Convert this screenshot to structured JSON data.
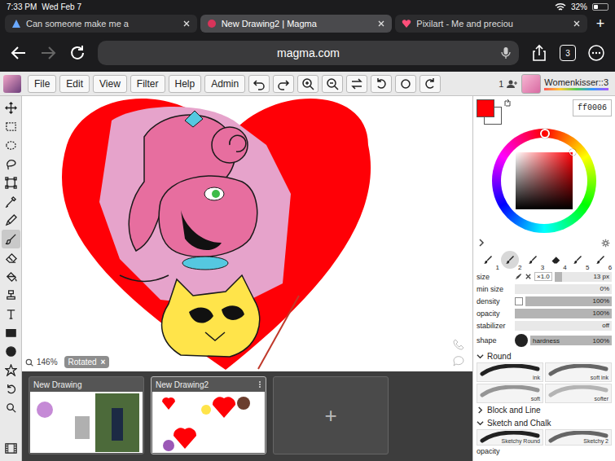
{
  "status_bar": {
    "time": "7:33 PM",
    "date": "Wed Feb 7",
    "battery": "32%",
    "battery_level": 0.32
  },
  "browser_tabs": [
    {
      "label": "Can someone make me a",
      "selected": false
    },
    {
      "label": "New Drawing2 | Magma",
      "selected": true
    },
    {
      "label": "Pixilart - Me and preciou",
      "selected": false
    }
  ],
  "new_tab": "+",
  "address_bar": {
    "url": "magma.com",
    "tab_count": "3"
  },
  "menu": [
    "File",
    "Edit",
    "View",
    "Filter",
    "Help",
    "Admin"
  ],
  "users": {
    "count": "1",
    "username": "Womenkisser::3"
  },
  "tools": [
    {
      "selected": false
    },
    {
      "selected": false
    },
    {
      "selected": false
    },
    {
      "selected": false
    },
    {
      "selected": false
    },
    {
      "selected": false
    },
    {
      "selected": false
    },
    {
      "selected": true
    },
    {
      "selected": false
    },
    {
      "selected": false
    },
    {
      "selected": false
    },
    {
      "selected": false
    },
    {
      "selected": false
    },
    {
      "selected": false
    },
    {
      "selected": false
    },
    {
      "selected": false
    },
    {
      "selected": false
    }
  ],
  "color": {
    "hex": "ff0006",
    "primary": "#ff0006",
    "secondary": "#ffffff"
  },
  "brush_slots": [
    {
      "label": "1",
      "kind": "brush",
      "selected": false
    },
    {
      "label": "2",
      "kind": "brush",
      "selected": true
    },
    {
      "label": "3",
      "kind": "brush",
      "selected": false
    },
    {
      "label": "4",
      "kind": "eraser",
      "selected": false
    },
    {
      "label": "5",
      "kind": "brush",
      "selected": false
    },
    {
      "label": "6",
      "kind": "brush",
      "selected": false
    }
  ],
  "brush_settings": [
    {
      "label": "size",
      "kind": "size",
      "multiplier": "×1.0",
      "level": 0.13,
      "reading": "13 px"
    },
    {
      "label": "min size",
      "kind": "slider",
      "level": 0,
      "reading": "0%"
    },
    {
      "label": "density",
      "kind": "check",
      "checked": false,
      "level": 1,
      "reading": "100%"
    },
    {
      "label": "opacity",
      "kind": "slider",
      "level": 1,
      "reading": "100%"
    },
    {
      "label": "stabilizer",
      "kind": "slider",
      "level": 0,
      "reading": "off"
    }
  ],
  "shape": {
    "label": "shape",
    "hardness_label": "hardness",
    "level": 1,
    "reading": "100%"
  },
  "brush_groups": [
    {
      "name": "Round",
      "expanded": true,
      "brushes": [
        "ink",
        "soft ink",
        "soft",
        "softer"
      ]
    },
    {
      "name": "Block and Line",
      "expanded": false,
      "brushes": []
    },
    {
      "name": "Sketch and Chalk",
      "expanded": true,
      "brushes": [
        "Sketchy Round",
        "Sketchy 2"
      ]
    }
  ],
  "panel_footer": "opacity",
  "canvas": {
    "zoom": "146%",
    "rotated": "Rotated",
    "rotated_close": "×"
  },
  "drawings": [
    {
      "name": "New Drawing",
      "selected": false
    },
    {
      "name": "New Drawing2",
      "selected": true
    }
  ],
  "add_drawing": "+"
}
